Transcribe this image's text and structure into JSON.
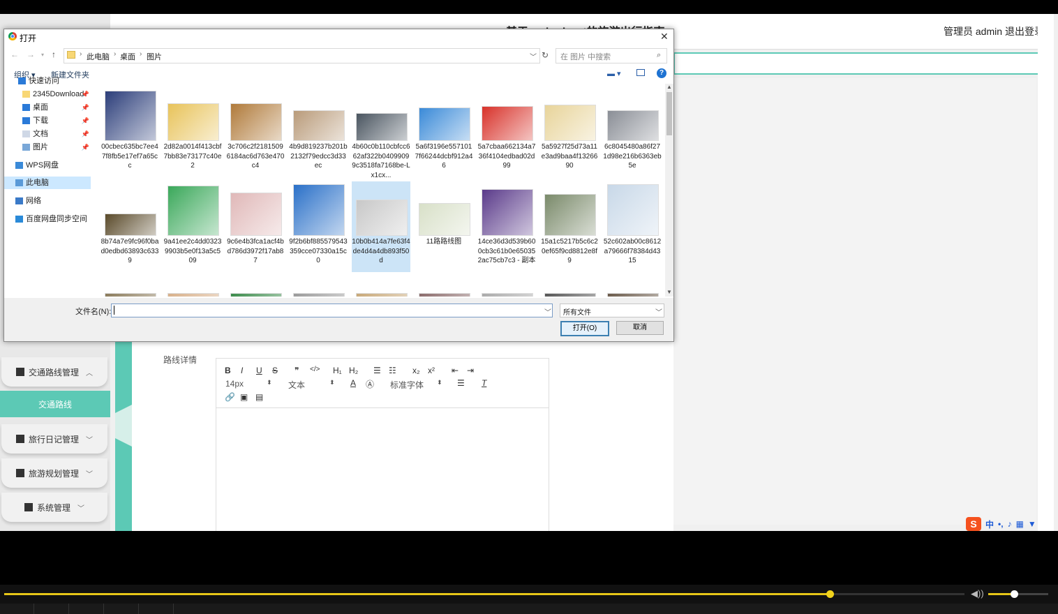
{
  "app": {
    "title": "基于springboot的旅游出行指南",
    "admin": "管理员 admin",
    "logout": "退出登录",
    "sidebar": [
      {
        "label": "交通路线管理",
        "icon": "grid-icon"
      },
      {
        "label": "旅行日记管理",
        "icon": "book-icon"
      },
      {
        "label": "旅游规划管理",
        "icon": "user-icon"
      },
      {
        "label": "系统管理",
        "icon": "monitor-icon"
      }
    ],
    "sidebar_active": "交通路线",
    "form_label": "路线详情",
    "editor": {
      "row1": [
        "B",
        "I",
        "U",
        "S",
        "❞",
        "</>",
        "H₁",
        "H₂",
        "☰",
        "☷",
        "x₂",
        "x²",
        "⇤",
        "⇥"
      ],
      "font_size": "14px",
      "block_type": "文本",
      "font_family": "标准字体"
    }
  },
  "dialog": {
    "title": "打开",
    "breadcrumb": [
      "此电脑",
      "桌面",
      "图片"
    ],
    "search_placeholder": "在 图片 中搜索",
    "organize": "组织 ▾",
    "new_folder": "新建文件夹",
    "nav": [
      {
        "label": "快速访问",
        "icon": "star-icon",
        "pinned": false
      },
      {
        "label": "2345Download",
        "icon": "folder-icon",
        "pinned": true
      },
      {
        "label": "桌面",
        "icon": "desktop-icon",
        "pinned": true
      },
      {
        "label": "下载",
        "icon": "download-icon",
        "pinned": true
      },
      {
        "label": "文档",
        "icon": "document-icon",
        "pinned": true
      },
      {
        "label": "图片",
        "icon": "pictures-icon",
        "pinned": true
      },
      {
        "label": "WPS网盘",
        "icon": "cloud-icon",
        "pinned": false
      },
      {
        "label": "此电脑",
        "icon": "computer-icon",
        "pinned": false
      },
      {
        "label": "网络",
        "icon": "network-icon",
        "pinned": false
      },
      {
        "label": "百度网盘同步空间",
        "icon": "sync-icon",
        "pinned": false
      }
    ],
    "nav_selected": "此电脑",
    "files": [
      {
        "name": "00cbec635bc7ee47f8fb5e17ef7a65cc",
        "color": "#2c3e7a"
      },
      {
        "name": "2d82a0014f413cbf7bb83e73177c40e2",
        "color": "#e8c35a"
      },
      {
        "name": "3c706c2f21815096184ac6d763e470c4",
        "color": "#b07a3a"
      },
      {
        "name": "4b9d819237b201b2132f79edcc3d33ec",
        "color": "#b99b7a"
      },
      {
        "name": "4b60c0b110cbfcc662af322b04099099c3518fa7168be-Lx1cx...",
        "color": "#4a5560"
      },
      {
        "name": "5a6f3196e5571017f66244dcbf912a46",
        "color": "#3a8ad8"
      },
      {
        "name": "5a7cbaa662134a736f4104edbad02d99",
        "color": "#d8322a"
      },
      {
        "name": "5a5927f25d73a11e3ad9baa4f1326690",
        "color": "#e8d49a"
      },
      {
        "name": "6c8045480a86f271d98e216b6363eb5e",
        "color": "#8a8e96"
      },
      {
        "name": "8b74a7e9fc96f0bad0edbd63893c6339",
        "color": "#5a4a2a"
      },
      {
        "name": "9a41ee2c4dd03239903b5e0f13a5c509",
        "color": "#3aa85a"
      },
      {
        "name": "9c6e4b3fca1acf4bd786d3972f17ab87",
        "color": "#e0b8b8"
      },
      {
        "name": "9f2b6bf885579543359cce07330a15c0",
        "color": "#2a70c8"
      },
      {
        "name": "10b0b414a7fe63f4de4d4a4db893f50d",
        "color": "#c8c8c8"
      },
      {
        "name": "11路路线图",
        "color": "#d8e0c8"
      },
      {
        "name": "14ce36d3d539b600cb3c61b0e650352ac75cb7c3 - 副本",
        "color": "#5a3a8a"
      },
      {
        "name": "15a1c5217b5c6c20ef65f9cd8812e8f9",
        "color": "#7a8a6a"
      },
      {
        "name": "52c602ab00c8612a79666f78384d4315",
        "color": "#c8d8e8"
      },
      {
        "name": "",
        "color": "#8a7a5a"
      },
      {
        "name": "",
        "color": "#d8b08a"
      },
      {
        "name": "",
        "color": "#3a8a4a"
      },
      {
        "name": "",
        "color": "#9a9a9a"
      },
      {
        "name": "",
        "color": "#c8a878"
      },
      {
        "name": "",
        "color": "#8a6a6a"
      },
      {
        "name": "",
        "color": "#aaaaaa"
      },
      {
        "name": "",
        "color": "#555555"
      },
      {
        "name": "",
        "color": "#6a5a4a"
      }
    ],
    "selected_file": "10b0b414a7fe63f4de4d4a4db893f50d",
    "filename_label": "文件名(N):",
    "filename_value": "",
    "filetype": "所有文件",
    "open_button": "打开(O)",
    "cancel_button": "取消"
  },
  "ime": {
    "mode": "中"
  },
  "player": {
    "progress": 0.86,
    "volume": 0.43,
    "accent": "#e6c618"
  }
}
